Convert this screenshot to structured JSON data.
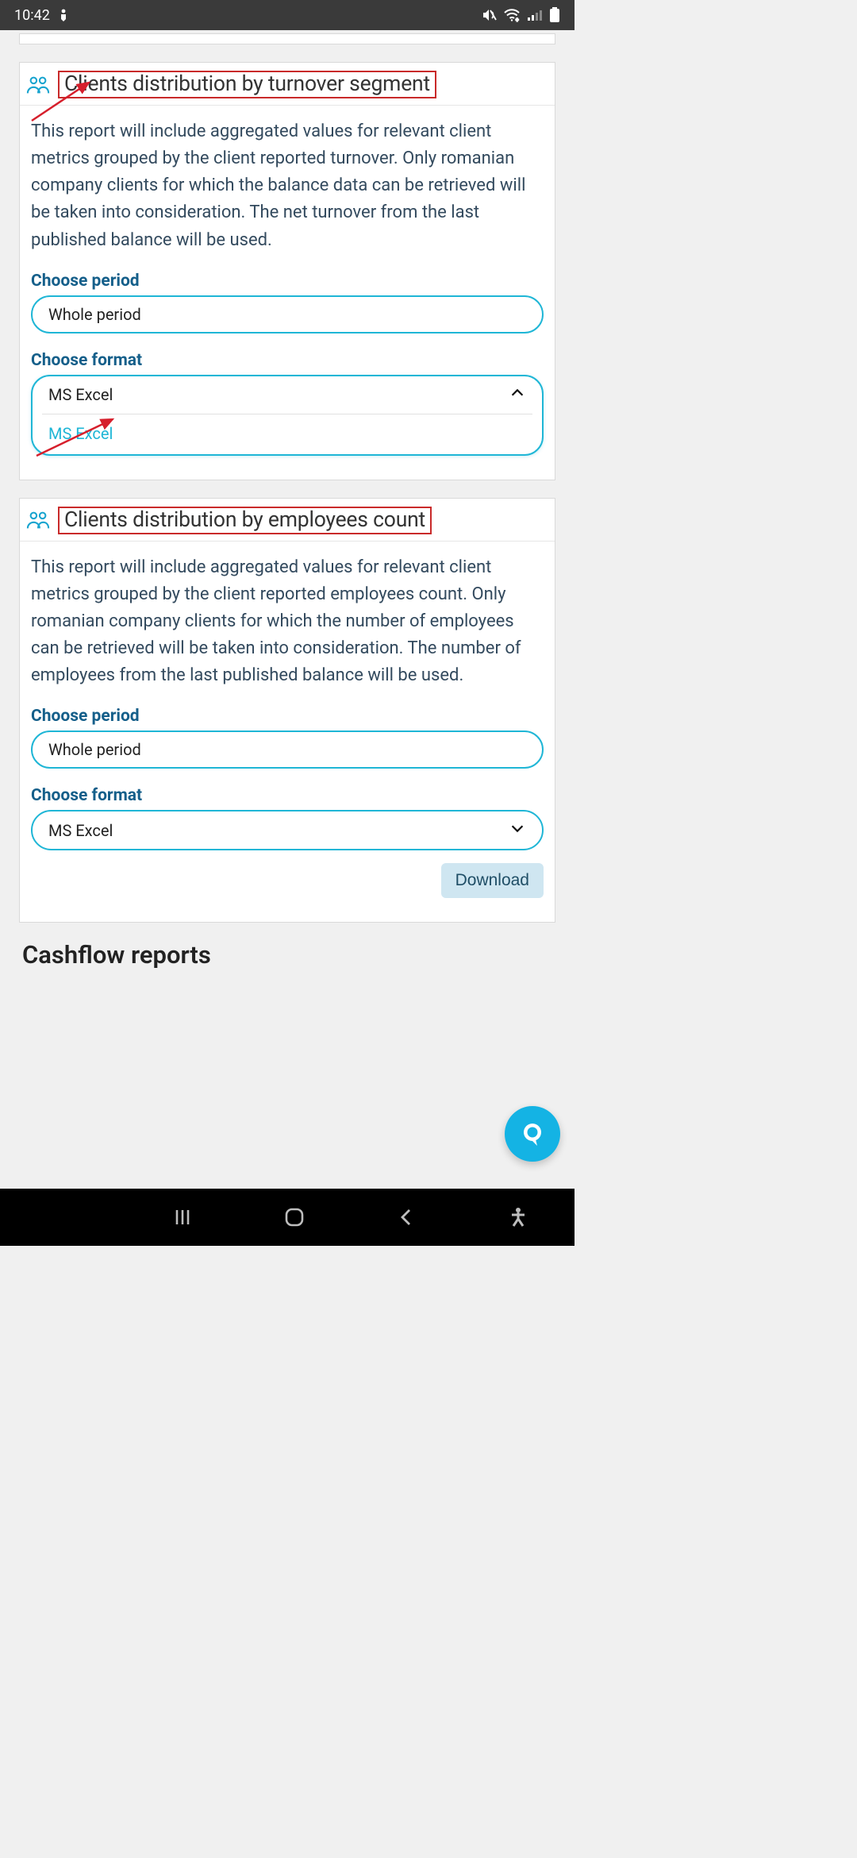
{
  "status": {
    "time": "10:42"
  },
  "card1": {
    "title": "Clients distribution by turnover segment",
    "desc": "This report will include aggregated values for relevant client metrics grouped by the client reported turnover. Only romanian company clients for which the balance data can be retrieved will be taken into consideration. The net turnover from the last published balance will be used.",
    "period_label": "Choose period",
    "period_value": "Whole period",
    "format_label": "Choose format",
    "format_value": "MS Excel",
    "format_option": "MS Excel"
  },
  "card2": {
    "title": "Clients distribution by employees count",
    "desc": "This report will include aggregated values for relevant client metrics grouped by the client reported employees count. Only romanian company clients for which the number of employees can be retrieved will be taken into consideration. The number of employees from the last published balance will be used.",
    "period_label": "Choose period",
    "period_value": "Whole period",
    "format_label": "Choose format",
    "format_value": "MS Excel",
    "download_label": "Download"
  },
  "section_title": "Cashflow reports"
}
